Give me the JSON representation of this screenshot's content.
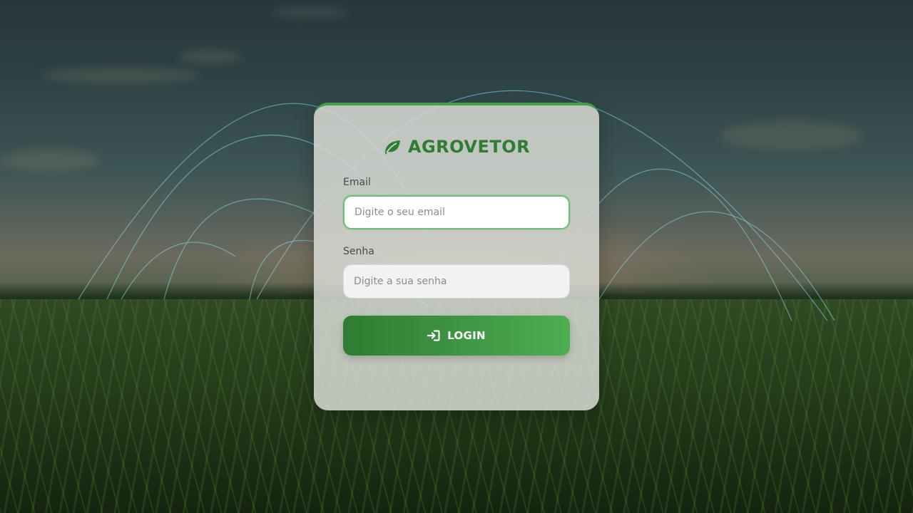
{
  "brand": {
    "title": "AGROVETOR",
    "icon": "leaf-icon",
    "color": "#2e7d32"
  },
  "form": {
    "email": {
      "label": "Email",
      "placeholder": "Digite o seu email",
      "value": ""
    },
    "password": {
      "label": "Senha",
      "placeholder": "Digite a sua senha",
      "value": ""
    },
    "login_button": {
      "label": "LOGIN",
      "icon": "sign-in-icon",
      "color": "#43a047"
    }
  },
  "colors": {
    "accent": "#43a047",
    "focus_border": "#6fbf73"
  }
}
